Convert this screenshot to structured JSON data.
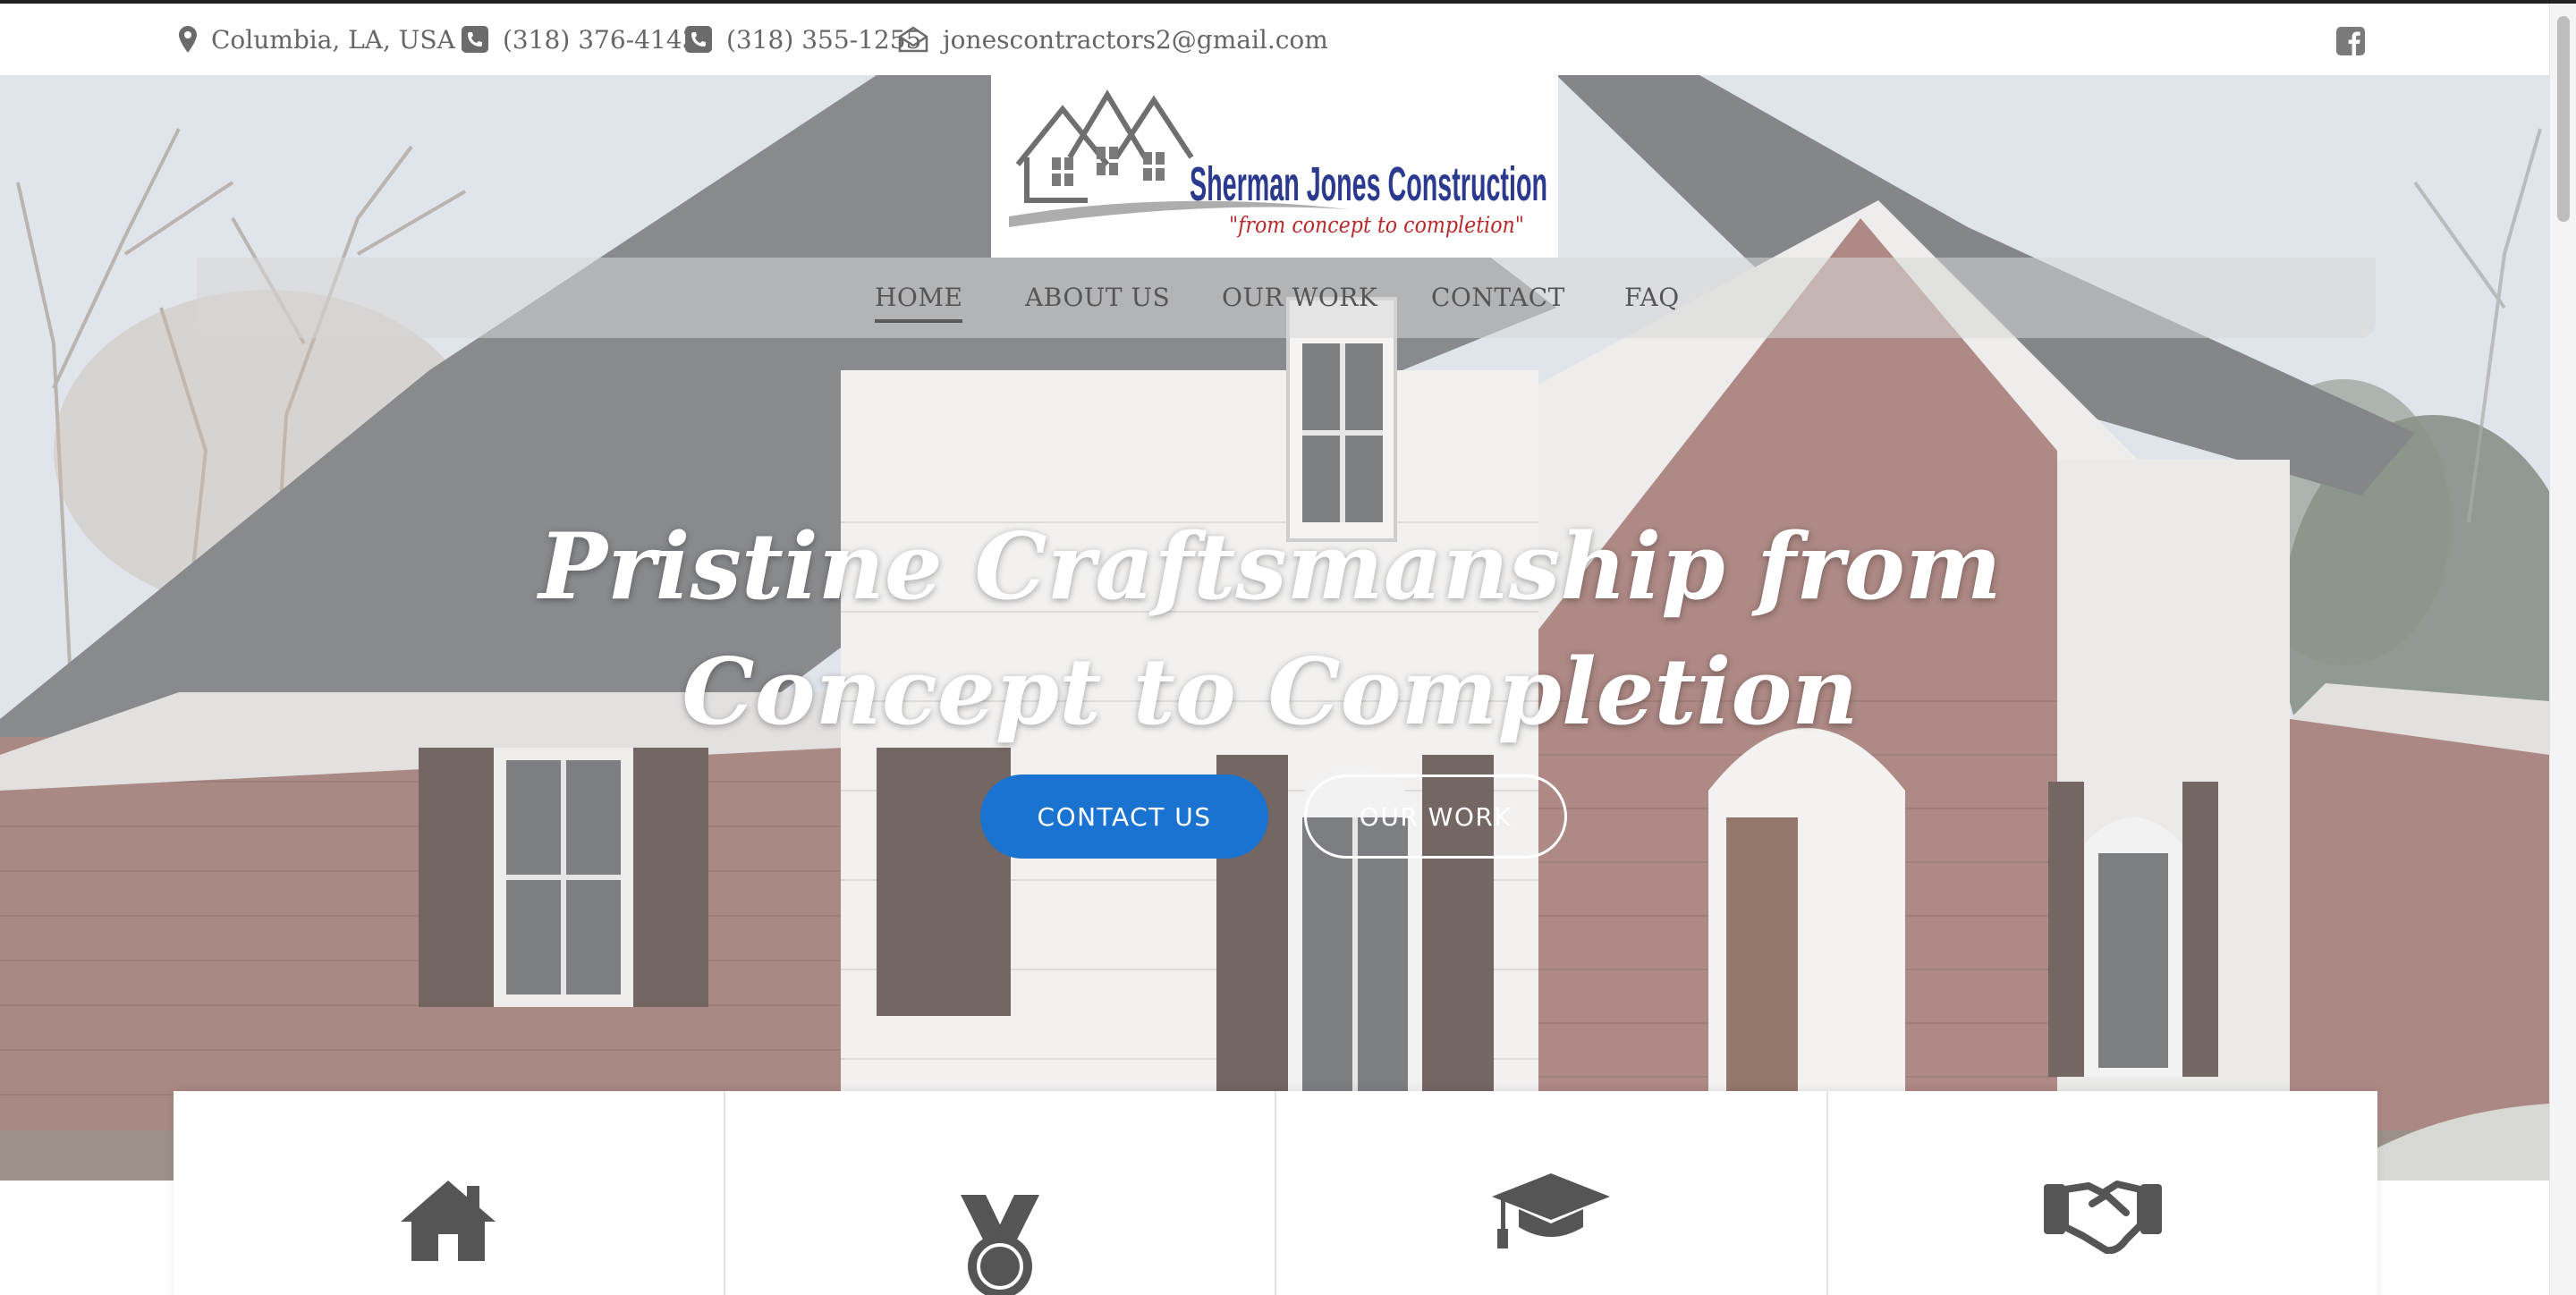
{
  "topbar": {
    "location": "Columbia, LA, USA",
    "phone1": "(318) 376-4143",
    "phone2": "(318) 355-1255",
    "email": "jonescontractors2@gmail.com",
    "social_icon": "facebook-icon"
  },
  "logo": {
    "company": "Sherman Jones Construction",
    "tagline": "\"from concept to completion\""
  },
  "nav": {
    "items": [
      {
        "label": "HOME",
        "active": true
      },
      {
        "label": "ABOUT US",
        "active": false
      },
      {
        "label": "OUR WORK",
        "active": false
      },
      {
        "label": "CONTACT",
        "active": false
      },
      {
        "label": "FAQ",
        "active": false
      }
    ]
  },
  "hero": {
    "headline_line1": "Pristine Craftsmanship from",
    "headline_line2": "Concept to Completion",
    "primary_button": "CONTACT US",
    "secondary_button": "OUR WORK"
  },
  "features": {
    "icons": [
      "home-icon",
      "medal-icon",
      "graduation-cap-icon",
      "handshake-icon"
    ]
  },
  "colors": {
    "accent_blue": "#1a73d0",
    "logo_blue": "#2b3a8f",
    "logo_red": "#b8282a",
    "text_gray": "#666666"
  }
}
